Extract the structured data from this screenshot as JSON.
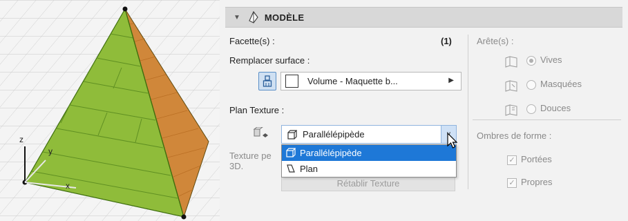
{
  "viewport": {
    "axis_z": "z",
    "axis_y": "y",
    "axis_x": "x",
    "colors": {
      "face_front": "#8fbc3a",
      "face_side": "#d6862e",
      "edge": "#3e6e0e"
    }
  },
  "panel": {
    "header": {
      "title": "MODÈLE",
      "icon": "model-icon"
    },
    "facettes": {
      "label": "Facette(s) :",
      "count": "(1)"
    },
    "remplacer": {
      "label": "Remplacer surface :",
      "surface_value": "Volume - Maquette b...",
      "brush_icon": "brush-icon"
    },
    "plan_texture": {
      "label": "Plan Texture :",
      "selected": "Parallélépipède",
      "options": [
        "Parallélépipède",
        "Plan"
      ],
      "texture_note_line1": "Texture pe",
      "texture_note_line2": "3D.",
      "reset_label": "Rétablir Texture"
    },
    "aretes": {
      "label": "Arête(s) :",
      "options": [
        {
          "label": "Vives",
          "selected": true
        },
        {
          "label": "Masquées",
          "selected": false
        },
        {
          "label": "Douces",
          "selected": false
        }
      ]
    },
    "ombres": {
      "label": "Ombres de forme :",
      "options": [
        {
          "label": "Portées",
          "checked": true
        },
        {
          "label": "Propres",
          "checked": true
        }
      ]
    },
    "accent": "#1e78d7"
  }
}
